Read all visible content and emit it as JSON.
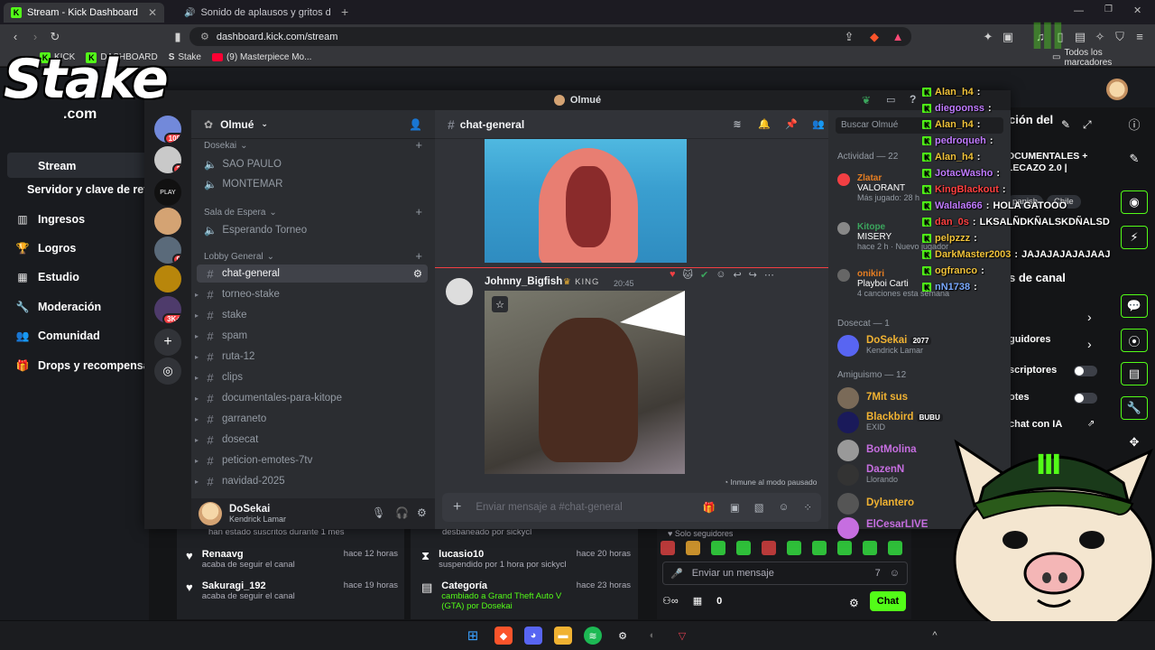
{
  "browser": {
    "tabs": [
      {
        "title": "Stream - Kick Dashboard",
        "active": true
      },
      {
        "title": "Sonido de aplausos y gritos d",
        "active": false
      }
    ],
    "url": "dashboard.kick.com/stream",
    "bookmarks": [
      "KICK",
      "DASHBOARD",
      "Stake",
      "(9) Masterpiece Mo..."
    ],
    "all_bookmarks": "Todos los marcadores"
  },
  "kick": {
    "sidebar": [
      {
        "label": "Stream",
        "icon": "broadcast-icon"
      },
      {
        "label": "Servidor y clave de ret",
        "icon": "key-icon"
      },
      {
        "label": "Ingresos",
        "icon": "chart-icon"
      },
      {
        "label": "Logros",
        "icon": "trophy-icon"
      },
      {
        "label": "Estudio",
        "icon": "studio-icon"
      },
      {
        "label": "Moderación",
        "icon": "wrench-icon"
      },
      {
        "label": "Comunidad",
        "icon": "community-icon"
      },
      {
        "label": "Drops y recompensa",
        "icon": "gift-icon"
      }
    ],
    "right_panel": {
      "title_partial": "ción del",
      "stream_title_line1": "OCUMENTALES +",
      "stream_title_line2": "LECAZO 2.0 | ",
      "tags": [
        "panish",
        "Chile"
      ],
      "section": "s de canal",
      "followers": "guidores",
      "subscribers": "scriptores",
      "emotes": "otes",
      "ai_chat": "chat con IA"
    },
    "activity": [
      {
        "name": "",
        "desc": "han estado suscritos durante 1 mes",
        "time": ""
      },
      {
        "name": "Renaavg",
        "desc": "acaba de seguir el canal",
        "time": "hace 12 horas"
      },
      {
        "name": "Sakuragi_192",
        "desc": "acaba de seguir el canal",
        "time": "hace 19 horas"
      }
    ],
    "mod_log": [
      {
        "name": "",
        "desc": "desbaneado por sickycl",
        "time": ""
      },
      {
        "name": "lucasio10",
        "desc": "suspendido por 1 hora por sickycl",
        "time": "hace 20 horas"
      },
      {
        "name": "Categoría",
        "desc": "cambiado a Grand Theft Auto V (GTA) por Dosekai",
        "time": "hace 23 horas"
      }
    ],
    "chat": {
      "followers_only": "Solo seguidores",
      "input_placeholder": "Enviar un mensaje",
      "count": "0",
      "send": "Chat"
    }
  },
  "discord": {
    "window_title": "Olmué",
    "server_name": "Olmué",
    "categories": [
      {
        "name": "Dosekai",
        "voice": [
          "SAO PAULO",
          "MONTEMAR"
        ]
      },
      {
        "name": "Sala de Espera",
        "voice": [
          "Esperando Torneo"
        ]
      },
      {
        "name": "Lobby General",
        "voice": []
      }
    ],
    "channels": [
      "chat-general",
      "torneo-stake",
      "stake",
      "spam",
      "ruta-12",
      "clips",
      "documentales-para-kitope",
      "garraneto",
      "dosecat",
      "peticion-emotes-7tv",
      "navidad-2025"
    ],
    "user": {
      "name": "DoSekai",
      "status": "Kendrick Lamar"
    },
    "guild_badges": [
      "108",
      "2",
      "9",
      "3K+"
    ],
    "chat": {
      "channel": "chat-general",
      "author": "Johnny_Bigfish",
      "badge": "KING",
      "time": "20:45",
      "immune": "Inmune al modo pausado",
      "input_placeholder": "Enviar mensaje a #chat-general"
    },
    "members": {
      "search": "Buscar Olmué",
      "activity_header": "Actividad — 22",
      "activities": [
        {
          "user": "Zlatar",
          "game": "VALORANT",
          "detail": "Más jugado: 28 h"
        },
        {
          "user": "Kitope",
          "game": "MISERY",
          "detail": "hace 2 h",
          "extra": "Nuevo jugador"
        },
        {
          "user": "onikiri",
          "game": "Playboi Carti",
          "detail": "4 canciones esta semana"
        }
      ],
      "dosecat_header": "Dosecat — 1",
      "dosecat": [
        {
          "name": "DoSekai",
          "tag": "2077",
          "sub": "Kendrick Lamar"
        }
      ],
      "amiguismo_header": "Amiguismo — 12",
      "amiguismo": [
        {
          "name": "7Mit sus",
          "color": "#f0b232",
          "sub": ""
        },
        {
          "name": "Blackbird",
          "color": "#f0b232",
          "sub": "EXID",
          "tag": "BUBU"
        },
        {
          "name": "BotMolina",
          "color": "#c66ee0",
          "sub": ""
        },
        {
          "name": "DazenN",
          "color": "#c66ee0",
          "sub": "Llorando"
        },
        {
          "name": "Dylantero",
          "color": "#f0b232",
          "sub": ""
        },
        {
          "name": "ElCesarLIVE",
          "color": "#c66ee0",
          "sub": ""
        }
      ]
    }
  },
  "overlay_chat": [
    {
      "user": "Alan_h4",
      "color": "#f0c23a",
      "msg": ""
    },
    {
      "user": "diegoonss",
      "color": "#c07bff",
      "msg": ""
    },
    {
      "user": "Alan_h4",
      "color": "#f0c23a",
      "msg": ""
    },
    {
      "user": "pedroqueh",
      "color": "#c07bff",
      "msg": ""
    },
    {
      "user": "Alan_h4",
      "color": "#f0c23a",
      "msg": ""
    },
    {
      "user": "JotacWasho",
      "color": "#c07bff",
      "msg": ""
    },
    {
      "user": "KingBlackout",
      "color": "#ff4040",
      "msg": ""
    },
    {
      "user": "Walala666",
      "color": "#c07bff",
      "msg": "HOLA GATOOO"
    },
    {
      "user": "dan_0s",
      "color": "#ff4040",
      "msg": "LKSALÑDKÑALSKDÑALSD"
    },
    {
      "user": "pelpzzz",
      "color": "#f0c23a",
      "msg": ""
    },
    {
      "user": "DarkMaster2003",
      "color": "#f0c23a",
      "msg": "JAJAJAJAJAJAAJ"
    },
    {
      "user": "ogfranco",
      "color": "#f0c23a",
      "msg": ""
    },
    {
      "user": "nN1738",
      "color": "#7aa9ff",
      "msg": ""
    }
  ],
  "brand": {
    "stake": "Stake",
    "stake_sub": ".com"
  },
  "colors": {
    "kick_green": "#53fc18",
    "discord_bg": "#313338"
  }
}
